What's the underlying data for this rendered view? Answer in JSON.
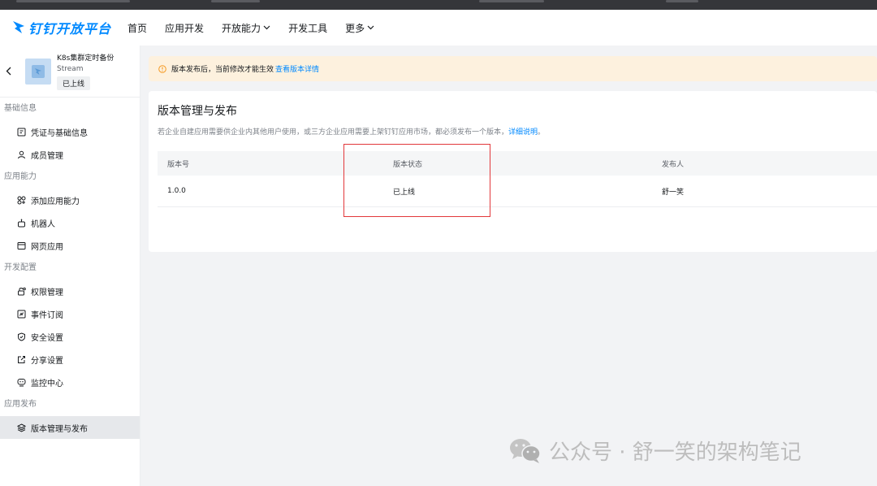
{
  "topnav": {
    "brand": "钉钉开放平台",
    "items": [
      {
        "label": "首页"
      },
      {
        "label": "应用开发"
      },
      {
        "label": "开放能力",
        "has_dropdown": true
      },
      {
        "label": "开发工具"
      },
      {
        "label": "更多",
        "has_dropdown": true
      }
    ]
  },
  "app": {
    "name": "K8s集群定时备份",
    "subtitle": "Stream",
    "status": "已上线"
  },
  "sidebar": {
    "sections": [
      {
        "title": "基础信息",
        "items": [
          {
            "label": "凭证与基础信息",
            "icon": "credential-icon"
          },
          {
            "label": "成员管理",
            "icon": "person-icon"
          }
        ]
      },
      {
        "title": "应用能力",
        "items": [
          {
            "label": "添加应用能力",
            "icon": "grid-add-icon"
          },
          {
            "label": "机器人",
            "icon": "robot-icon"
          },
          {
            "label": "网页应用",
            "icon": "browser-window-icon"
          }
        ]
      },
      {
        "title": "开发配置",
        "items": [
          {
            "label": "权限管理",
            "icon": "lock-icon"
          },
          {
            "label": "事件订阅",
            "icon": "event-icon"
          },
          {
            "label": "安全设置",
            "icon": "shield-icon"
          },
          {
            "label": "分享设置",
            "icon": "share-icon"
          },
          {
            "label": "监控中心",
            "icon": "monitor-icon"
          }
        ]
      },
      {
        "title": "应用发布",
        "items": [
          {
            "label": "版本管理与发布",
            "icon": "layers-icon",
            "active": true
          }
        ]
      }
    ]
  },
  "notice": {
    "text": "版本发布后，当前修改才能生效",
    "link": "查看版本详情"
  },
  "main": {
    "title": "版本管理与发布",
    "description": "若企业自建应用需要供企业内其他用户使用，或三方企业应用需要上架钉钉应用市场，都必须发布一个版本，",
    "description_link": "详细说明",
    "description_end": "。",
    "table": {
      "headers": [
        "版本号",
        "版本状态",
        "发布人"
      ],
      "rows": [
        [
          "1.0.0",
          "已上线",
          "舒一笑"
        ]
      ]
    }
  },
  "watermark": "公众号 · 舒一笑的架构笔记",
  "colors": {
    "accent": "#0089ff",
    "notice_bg": "#fdf1de",
    "highlight": "#e2383b"
  }
}
